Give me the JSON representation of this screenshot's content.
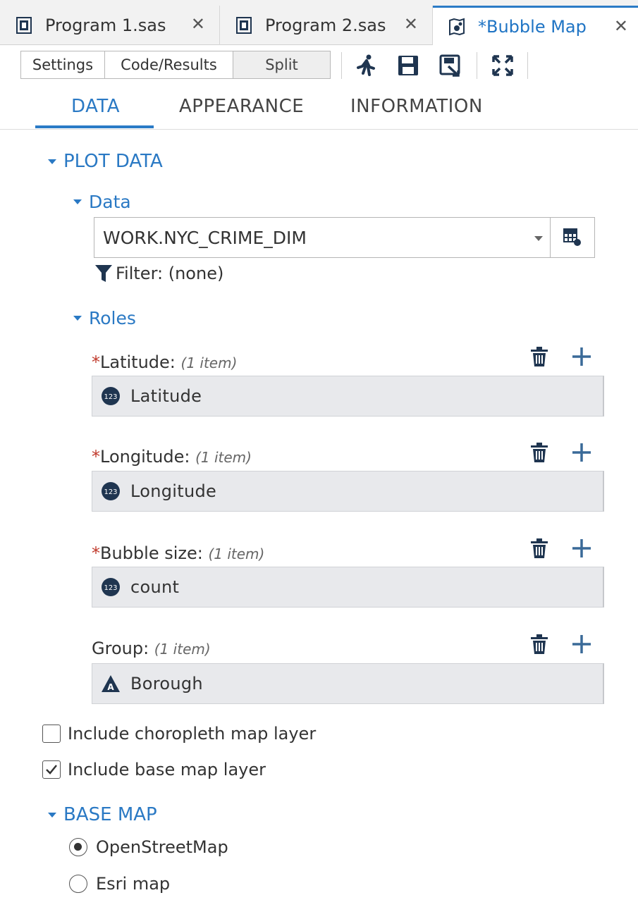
{
  "tabs": [
    {
      "label": "Program 1.sas",
      "close": "✕",
      "icon": "sas-program-icon"
    },
    {
      "label": "Program 2.sas",
      "close": "✕",
      "icon": "sas-program-icon"
    },
    {
      "label": "*Bubble Map",
      "close": "✕",
      "icon": "bubble-map-icon",
      "active": true
    }
  ],
  "toolbar": {
    "segments": [
      "Settings",
      "Code/Results",
      "Split"
    ],
    "selected_segment": "Split",
    "icons": [
      "run-icon",
      "save-icon",
      "save-as-icon",
      "maximize-icon"
    ]
  },
  "subtabs": [
    "DATA",
    "APPEARANCE",
    "INFORMATION"
  ],
  "active_subtab": "DATA",
  "plot_data": {
    "heading": "PLOT DATA",
    "data_heading": "Data",
    "dataset": "WORK.NYC_CRIME_DIM",
    "filter": "Filter: (none)",
    "roles_heading": "Roles",
    "roles": [
      {
        "required_mark": "*",
        "label": "Latitude:",
        "count": "(1 item)",
        "value": "Latitude",
        "type_icon": "numeric-icon"
      },
      {
        "required_mark": "*",
        "label": "Longitude:",
        "count": "(1 item)",
        "value": "Longitude",
        "type_icon": "numeric-icon"
      },
      {
        "required_mark": "*",
        "label": "Bubble size:",
        "count": "(1 item)",
        "value": "count",
        "type_icon": "numeric-icon"
      },
      {
        "required_mark": "",
        "label": "Group:",
        "count": "(1 item)",
        "value": "Borough",
        "type_icon": "character-icon"
      }
    ]
  },
  "options": {
    "choropleth_label": "Include choropleth map layer",
    "choropleth_checked": false,
    "basemap_layer_label": "Include base map layer",
    "basemap_layer_checked": true
  },
  "base_map": {
    "heading": "BASE MAP",
    "options": [
      "OpenStreetMap",
      "Esri map"
    ],
    "selected": "OpenStreetMap"
  },
  "colors": {
    "accent": "#2b7bc6",
    "required": "#c0392b",
    "icon_dark": "#1f3550"
  }
}
